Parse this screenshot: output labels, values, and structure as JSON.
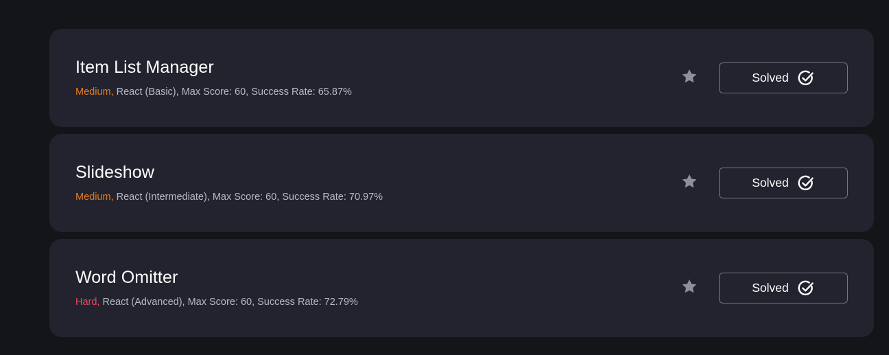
{
  "colors": {
    "background": "#141519",
    "card": "#22232e",
    "medium": "#e27a1f",
    "hard": "#f2455a",
    "meta_text": "#b9bac3",
    "star": "#8e8f99"
  },
  "challenges": [
    {
      "title": "Item List Manager",
      "difficulty": "Medium,",
      "details": "React (Basic), Max Score: 60, Success Rate: 65.87%",
      "star_icon": "star-icon",
      "status_label": "Solved",
      "status_icon": "check-circle-icon"
    },
    {
      "title": "Slideshow",
      "difficulty": "Medium,",
      "details": "React (Intermediate), Max Score: 60, Success Rate: 70.97%",
      "star_icon": "star-icon",
      "status_label": "Solved",
      "status_icon": "check-circle-icon"
    },
    {
      "title": "Word Omitter",
      "difficulty": "Hard,",
      "details": "React (Advanced), Max Score: 60, Success Rate: 72.79%",
      "star_icon": "star-icon",
      "status_label": "Solved",
      "status_icon": "check-circle-icon"
    }
  ]
}
